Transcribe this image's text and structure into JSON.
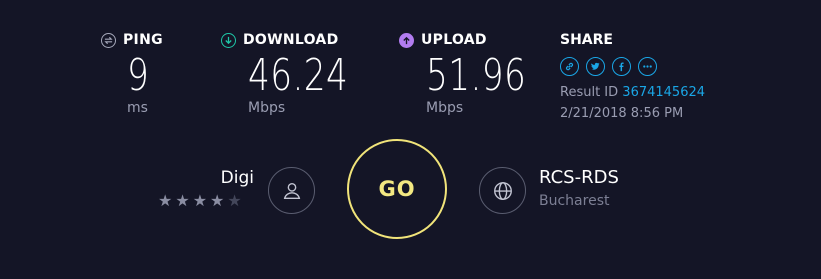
{
  "ping": {
    "label": "PING",
    "value": "9",
    "unit": "ms",
    "icon": "ping-icon"
  },
  "download": {
    "label": "DOWNLOAD",
    "value": "46.24",
    "unit": "Mbps",
    "icon": "download-arrow-icon",
    "color": "#1ec8a8"
  },
  "upload": {
    "label": "UPLOAD",
    "value": "51.96",
    "unit": "Mbps",
    "icon": "upload-arrow-icon",
    "color": "#b27cf0"
  },
  "share": {
    "label": "SHARE",
    "icons": [
      "link-icon",
      "twitter-icon",
      "facebook-icon",
      "more-icon"
    ],
    "result_label": "Result ID",
    "result_id": "3674145624",
    "datetime": "2/21/2018 8:56 PM",
    "accent": "#1aa6e6"
  },
  "isp": {
    "name": "Digi",
    "rating": 4,
    "rating_max": 5,
    "icon": "user-icon"
  },
  "go_button": {
    "label": "GO",
    "color": "#f1e47a"
  },
  "server": {
    "name": "RCS-RDS",
    "location": "Bucharest",
    "icon": "globe-icon"
  },
  "theme": {
    "background": "#141526",
    "muted": "#9a9db2"
  }
}
